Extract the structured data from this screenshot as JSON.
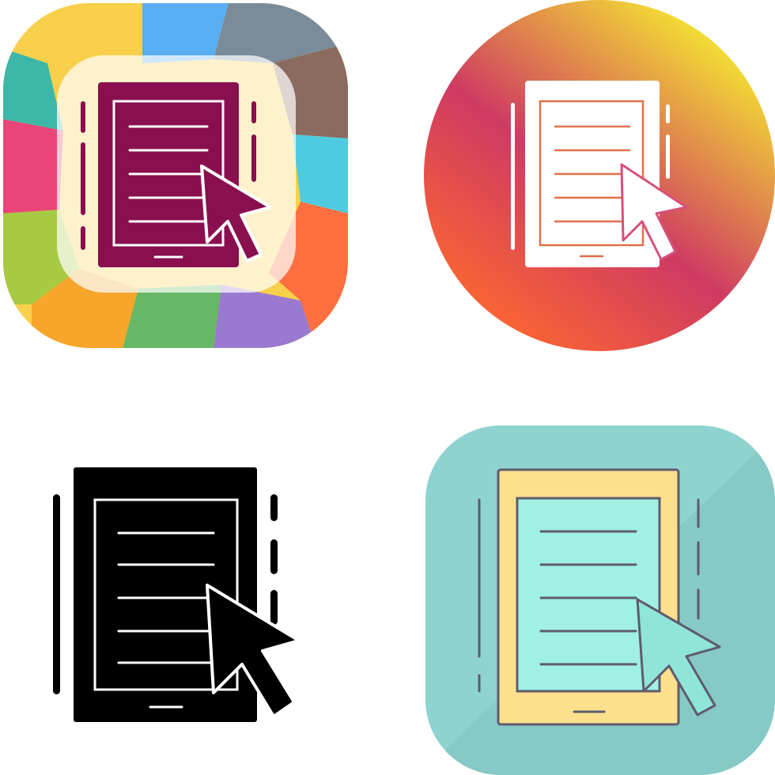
{
  "icon_set": {
    "subject": "tablet-document-cursor-icon",
    "variants": [
      {
        "style": "colorful-mosaic",
        "background_shape": "rounded-square",
        "colors": {
          "device": "#8a0f4f",
          "overlay": "#ffffff",
          "tiles": [
            "#f9d04b",
            "#5aaef2",
            "#7a8b99",
            "#8b6a60",
            "#4ecbe0",
            "#ff6f3f",
            "#9a7ad0",
            "#66b866",
            "#f7a52b",
            "#a8c943",
            "#e94578",
            "#3db8a8"
          ]
        }
      },
      {
        "style": "gradient-circle",
        "background_shape": "circle",
        "colors": {
          "gradient": [
            "#f7f12e",
            "#cf3a63",
            "#ff6a2e"
          ],
          "glyph": "#ffffff"
        }
      },
      {
        "style": "glyph",
        "background_shape": "none",
        "colors": {
          "glyph": "#000000",
          "lines": "#ffffff"
        }
      },
      {
        "style": "filled-line",
        "background_shape": "rounded-square",
        "colors": {
          "background": "#8fd3d0",
          "device": "#fde08c",
          "screen": "#a0f0e4",
          "outline": "#5f5b6f"
        }
      }
    ]
  }
}
